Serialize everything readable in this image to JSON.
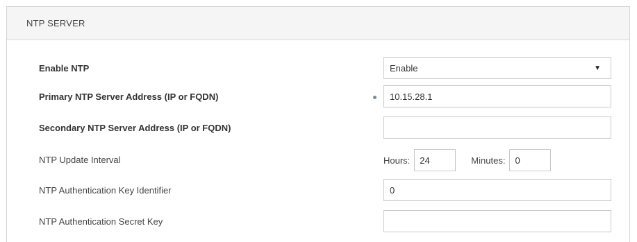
{
  "panel": {
    "title": "NTP SERVER"
  },
  "fields": {
    "enable_ntp": {
      "label": "Enable NTP",
      "value": "Enable"
    },
    "primary_server": {
      "label": "Primary NTP Server Address (IP or FQDN)",
      "value": "10.15.28.1"
    },
    "secondary_server": {
      "label": "Secondary NTP Server Address (IP or FQDN)",
      "value": ""
    },
    "update_interval": {
      "label": "NTP Update Interval",
      "hours_label": "Hours:",
      "hours_value": "24",
      "minutes_label": "Minutes:",
      "minutes_value": "0"
    },
    "auth_key_id": {
      "label": "NTP Authentication Key Identifier",
      "value": "0"
    },
    "auth_secret_key": {
      "label": "NTP Authentication Secret Key",
      "value": ""
    }
  },
  "icons": {
    "dropdown": "caret-down-icon",
    "required": "required-dot-icon"
  }
}
